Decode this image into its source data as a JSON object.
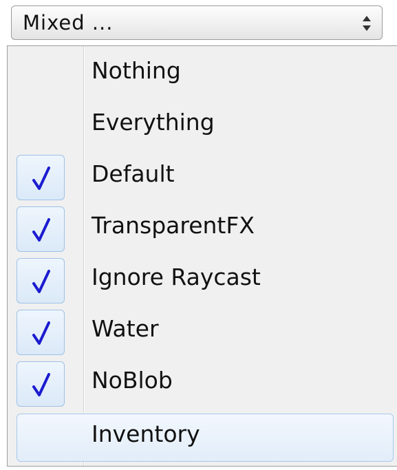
{
  "select": {
    "value": "Mixed ..."
  },
  "menu": {
    "items": [
      {
        "label": "Nothing",
        "checked": false
      },
      {
        "label": "Everything",
        "checked": false
      },
      {
        "label": "Default",
        "checked": true
      },
      {
        "label": "TransparentFX",
        "checked": true
      },
      {
        "label": "Ignore Raycast",
        "checked": true
      },
      {
        "label": "Water",
        "checked": true
      },
      {
        "label": "NoBlob",
        "checked": true
      },
      {
        "label": "Inventory",
        "checked": false,
        "hovered": true
      }
    ]
  },
  "colors": {
    "check": "#1b1bd0",
    "hover_border": "#a8c8ec"
  },
  "icons": {
    "check": "checkmark-icon",
    "select_arrows": "up-down-arrows-icon"
  }
}
